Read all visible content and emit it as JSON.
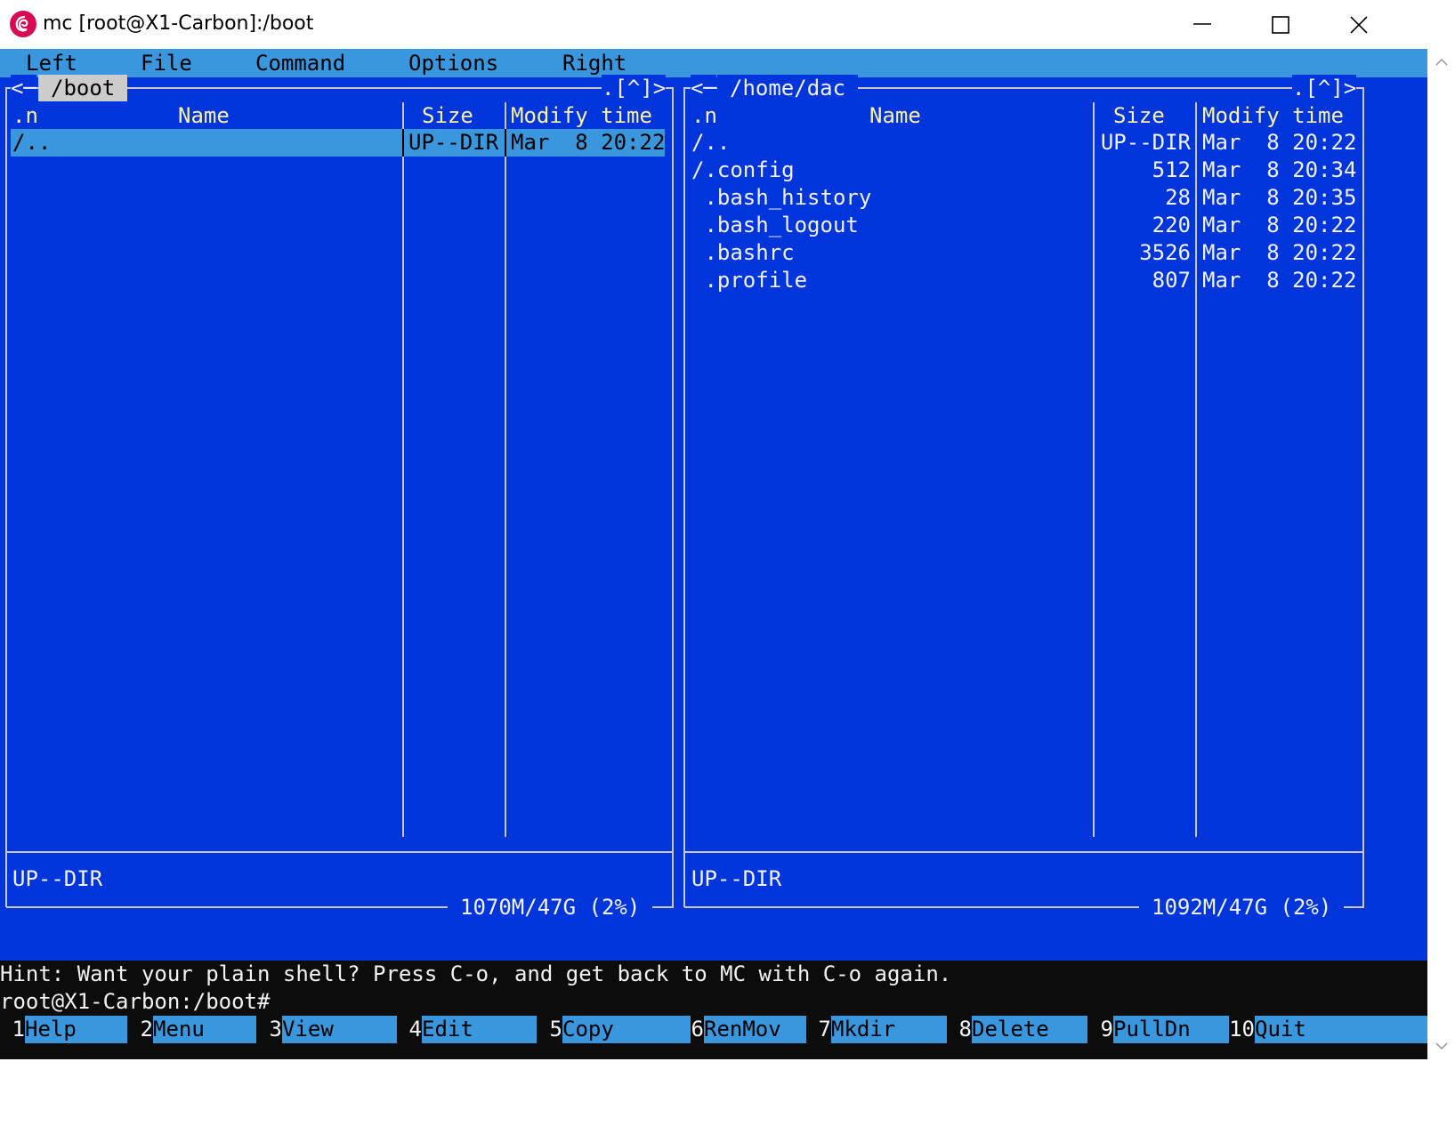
{
  "window": {
    "title": "mc [root@X1-Carbon]:/boot",
    "icon": "debian-swirl-icon",
    "controls": [
      "minimize-icon",
      "maximize-icon",
      "close-icon"
    ]
  },
  "menubar": {
    "items": [
      "Left",
      "File",
      "Command",
      "Options",
      "Right"
    ]
  },
  "left_panel": {
    "path": "/boot",
    "frame_left": "<─",
    "frame_right": ".[^]>",
    "headers": {
      "sort": ".n",
      "name": "Name",
      "size": "Size",
      "time": "Modify time"
    },
    "rows": [
      {
        "name": "/..",
        "size": "UP--DIR",
        "time": "Mar  8 20:22",
        "selected": true
      }
    ],
    "status": "UP--DIR",
    "disk": "1070M/47G (2%)"
  },
  "right_panel": {
    "path": "/home/dac",
    "frame_left": "<─",
    "frame_right": ".[^]>",
    "headers": {
      "sort": ".n",
      "name": "Name",
      "size": "Size",
      "time": "Modify time"
    },
    "rows": [
      {
        "name": "/..",
        "size": "UP--DIR",
        "time": "Mar  8 20:22"
      },
      {
        "name": "/.config",
        "size": "512",
        "time": "Mar  8 20:34"
      },
      {
        "name": " .bash_history",
        "size": "28",
        "time": "Mar  8 20:35"
      },
      {
        "name": " .bash_logout",
        "size": "220",
        "time": "Mar  8 20:22"
      },
      {
        "name": " .bashrc",
        "size": "3526",
        "time": "Mar  8 20:22"
      },
      {
        "name": " .profile",
        "size": "807",
        "time": "Mar  8 20:22"
      }
    ],
    "status": "UP--DIR",
    "disk": "1092M/47G (2%)"
  },
  "hint": "Hint: Want your plain shell? Press C-o, and get back to MC with C-o again.",
  "prompt": "root@X1-Carbon:/boot#",
  "fkeys": [
    {
      "num": "1",
      "label": "Help"
    },
    {
      "num": "2",
      "label": "Menu"
    },
    {
      "num": "3",
      "label": "View"
    },
    {
      "num": "4",
      "label": "Edit"
    },
    {
      "num": "5",
      "label": "Copy"
    },
    {
      "num": "6",
      "label": "RenMov"
    },
    {
      "num": "7",
      "label": "Mkdir"
    },
    {
      "num": "8",
      "label": "Delete"
    },
    {
      "num": "9",
      "label": "PullDn"
    },
    {
      "num": "10",
      "label": "Quit"
    }
  ],
  "colors": {
    "panel_bg": "#0135dc",
    "menubar_bg": "#3a96dd",
    "header_fg": "#f9f1a5",
    "text_fg": "#f2f2f2",
    "frame": "#c8c8c8"
  }
}
